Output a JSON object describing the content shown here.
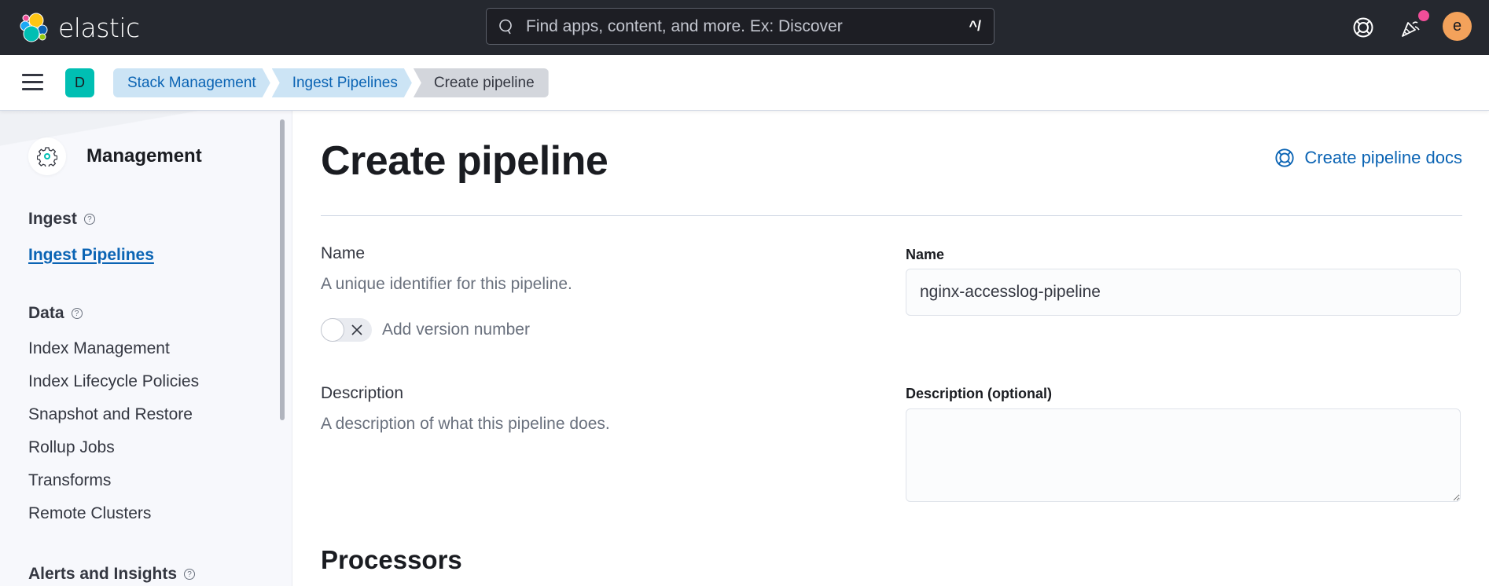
{
  "header": {
    "logo_text": "elastic",
    "search": {
      "placeholder": "Find apps, content, and more. Ex: Discover",
      "shortcut": "^/"
    },
    "help_icon": "help-lifebuoy-icon",
    "news_icon": "newsfeed-cheer-icon",
    "user_initial": "e",
    "colors": {
      "bg": "#25282f",
      "avatar": "#f3a25b",
      "badge": "#f04e98"
    }
  },
  "breadcrumb_bar": {
    "space_initial": "D",
    "crumbs": [
      {
        "label": "Stack Management"
      },
      {
        "label": "Ingest Pipelines"
      },
      {
        "label": "Create pipeline"
      }
    ]
  },
  "sidebar": {
    "title": "Management",
    "groups": [
      {
        "label": "Ingest",
        "items": [
          {
            "label": "Ingest Pipelines",
            "active": true
          }
        ]
      },
      {
        "label": "Data",
        "items": [
          {
            "label": "Index Management"
          },
          {
            "label": "Index Lifecycle Policies"
          },
          {
            "label": "Snapshot and Restore"
          },
          {
            "label": "Rollup Jobs"
          },
          {
            "label": "Transforms"
          },
          {
            "label": "Remote Clusters"
          }
        ]
      },
      {
        "label": "Alerts and Insights",
        "items": []
      }
    ]
  },
  "main": {
    "title": "Create pipeline",
    "docs_link": "Create pipeline docs",
    "name_section": {
      "title": "Name",
      "description": "A unique identifier for this pipeline.",
      "version_toggle": {
        "label": "Add version number",
        "checked": false
      }
    },
    "name_field": {
      "label": "Name",
      "value": "nginx-accesslog-pipeline"
    },
    "description_section": {
      "title": "Description",
      "description": "A description of what this pipeline does."
    },
    "description_field": {
      "label": "Description (optional)",
      "value": ""
    },
    "processors_title": "Processors"
  }
}
